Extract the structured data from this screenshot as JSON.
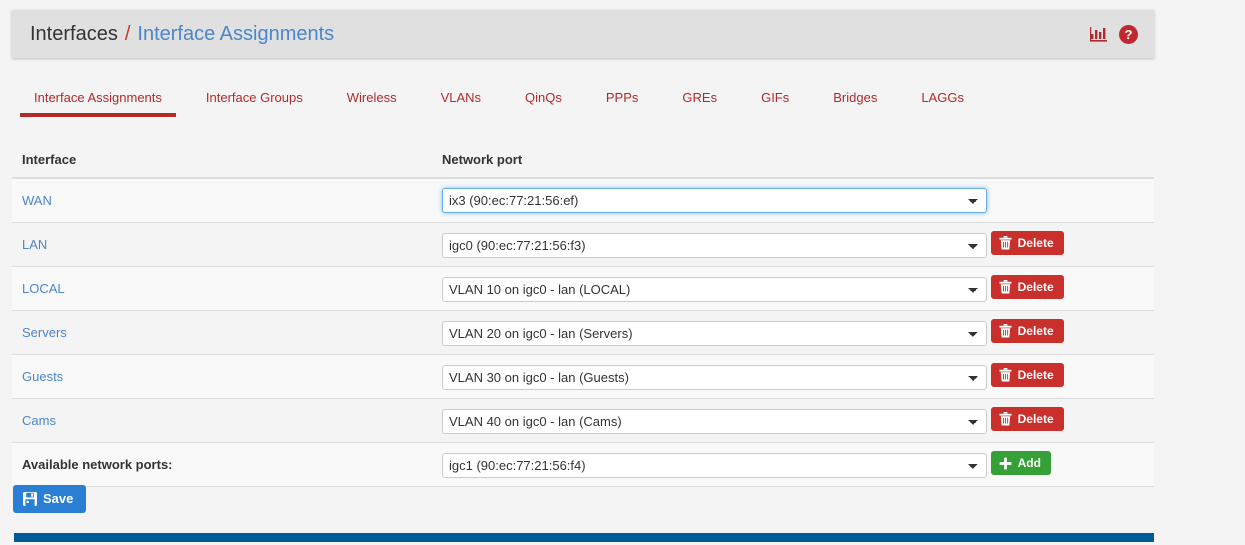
{
  "header": {
    "breadcrumb_root": "Interfaces",
    "breadcrumb_separator": "/",
    "breadcrumb_current": "Interface Assignments",
    "icons": [
      {
        "name": "stats-icon",
        "title": "Status Monitoring"
      },
      {
        "name": "help-icon",
        "title": "Help"
      }
    ],
    "accent_color": "#b02b2b",
    "link_color": "#4d85c9"
  },
  "tabs": [
    {
      "label": "Interface Assignments",
      "active": true
    },
    {
      "label": "Interface Groups",
      "active": false
    },
    {
      "label": "Wireless",
      "active": false
    },
    {
      "label": "VLANs",
      "active": false
    },
    {
      "label": "QinQs",
      "active": false
    },
    {
      "label": "PPPs",
      "active": false
    },
    {
      "label": "GREs",
      "active": false
    },
    {
      "label": "GIFs",
      "active": false
    },
    {
      "label": "Bridges",
      "active": false
    },
    {
      "label": "LAGGs",
      "active": false
    }
  ],
  "table": {
    "columns": {
      "interface": "Interface",
      "network_port": "Network port"
    },
    "rows": [
      {
        "interface": "WAN",
        "port": "ix3 (90:ec:77:21:56:ef)",
        "focused": true,
        "delete_label": null
      },
      {
        "interface": "LAN",
        "port": "igc0 (90:ec:77:21:56:f3)",
        "focused": false,
        "delete_label": "Delete"
      },
      {
        "interface": "LOCAL",
        "port": "VLAN 10 on igc0 - lan (LOCAL)",
        "focused": false,
        "delete_label": "Delete"
      },
      {
        "interface": "Servers",
        "port": "VLAN 20 on igc0 - lan (Servers)",
        "focused": false,
        "delete_label": "Delete"
      },
      {
        "interface": "Guests",
        "port": "VLAN 30 on igc0 - lan (Guests)",
        "focused": false,
        "delete_label": "Delete"
      },
      {
        "interface": "Cams",
        "port": "VLAN 40 on igc0 - lan (Cams)",
        "focused": false,
        "delete_label": "Delete"
      }
    ],
    "available": {
      "label": "Available network ports:",
      "port": "igc1 (90:ec:77:21:56:f4)",
      "add_label": "Add"
    }
  },
  "actions": {
    "save_label": "Save"
  },
  "colors": {
    "delete_button": "#c9302c",
    "add_button": "#35a035",
    "save_button": "#2a7fd4",
    "bottom_strip": "#005c99"
  }
}
